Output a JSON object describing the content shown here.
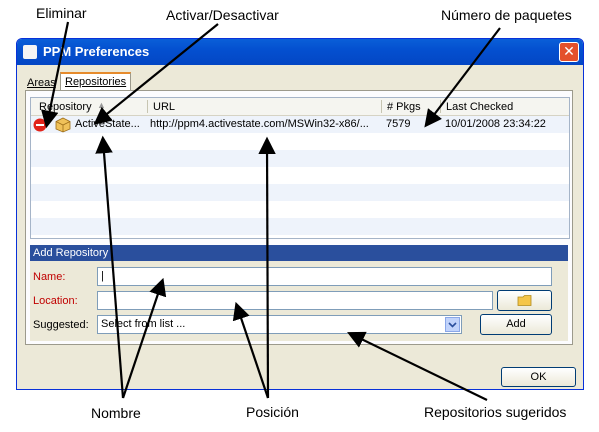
{
  "annotations": {
    "delete": "Eliminar",
    "toggle": "Activar/Desactivar",
    "pkg_count": "Número de paquetes",
    "name": "Nombre",
    "position": "Posición",
    "suggested": "Repositorios sugeridos"
  },
  "window": {
    "title": "PPM Preferences",
    "close_glyph": "✕"
  },
  "tabs": [
    {
      "label": "Areas",
      "active": false
    },
    {
      "label": "Repositories",
      "active": true
    }
  ],
  "repo_table": {
    "columns": [
      "Repository",
      "URL",
      "# Pkgs",
      "Last Checked"
    ],
    "sort_indicator": "▲",
    "rows": [
      {
        "name": "ActiveState...",
        "url": "http://ppm4.activestate.com/MSWin32-x86/...",
        "pkgs": "7579",
        "last_checked": "10/01/2008 23:34:22"
      }
    ]
  },
  "add_repository": {
    "header": "Add Repository",
    "name_label": "Name:",
    "name_value": "|",
    "location_label": "Location:",
    "location_value": "",
    "suggested_label": "Suggested:",
    "suggested_value": "Select from list ...",
    "add_label": "Add",
    "browse_icon": "folder-icon",
    "dropdown_icon": "chevron-down-icon"
  },
  "footer": {
    "ok_label": "OK"
  },
  "colors": {
    "titlebar": "#0450d0",
    "close": "#e4502c",
    "section_header": "#2a4f9d",
    "required_label": "#c00000",
    "delete_icon": "#e2231a",
    "toggle_icon": "#e8b14a"
  }
}
